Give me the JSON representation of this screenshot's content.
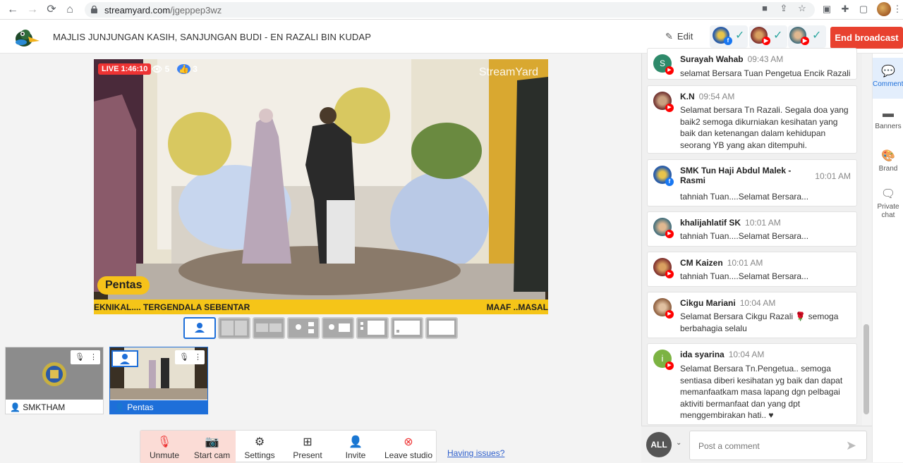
{
  "browser": {
    "url_host": "streamyard.com",
    "url_path": "/jgeppep3wz",
    "nav": [
      "back-icon",
      "forward-icon",
      "reload-icon",
      "home-icon"
    ]
  },
  "header": {
    "title": "MAJLIS JUNJUNGAN KASIH, SANJUNGAN BUDI - EN RAZALI BIN KUDAP",
    "edit_label": "Edit",
    "end_label": "End broadcast",
    "colors": {
      "end": "#e8412f",
      "check": "#2ea7a0"
    }
  },
  "stage": {
    "live_label": "LIVE 1:46:10",
    "viewers": "5",
    "likes": "3",
    "watermark": "StreamYard",
    "name_badge": "Pentas",
    "ticker_left": "EKNIKAL.... TERGENDALA SEBENTAR",
    "ticker_right": "MAAF ..MASAL",
    "colors": {
      "live": "#e33333",
      "ticker": "#f5c518"
    }
  },
  "tiles": [
    {
      "name": "SMKTHAM"
    },
    {
      "name": "Pentas"
    }
  ],
  "toolbar": {
    "unmute": "Unmute",
    "start_cam": "Start cam",
    "settings": "Settings",
    "present": "Present",
    "invite": "Invite",
    "leave": "Leave studio",
    "issues": "Having issues?"
  },
  "comments": [
    {
      "name": "Surayah Wahab",
      "time": "09:43 AM",
      "text": "selamat Bersara Tuan Pengetua Encik Razali",
      "source": "youtube"
    },
    {
      "name": "K.N",
      "time": "09:54 AM",
      "text": "Selamat bersara Tn Razali. Segala doa yang baik2 semoga dikurniakan kesihatan yang baik dan ketenangan dalam kehidupan seorang YB yang akan ditempuhi.",
      "source": "youtube"
    },
    {
      "name": "SMK Tun Haji Abdul Malek - Rasmi",
      "time": "10:01 AM",
      "text": "tahniah Tuan....Selamat Bersara...",
      "source": "facebook"
    },
    {
      "name": "khalijahlatif SK",
      "time": "10:01 AM",
      "text": "tahniah Tuan....Selamat Bersara...",
      "source": "youtube"
    },
    {
      "name": "CM Kaizen",
      "time": "10:01 AM",
      "text": "tahniah Tuan....Selamat Bersara...",
      "source": "youtube"
    },
    {
      "name": "Cikgu Mariani",
      "time": "10:04 AM",
      "text": "Selamat Bersara Cikgu Razali 🌹 semoga berbahagia selalu",
      "source": "youtube"
    },
    {
      "name": "ida syarina",
      "time": "10:04 AM",
      "text": "Selamat Bersara Tn.Pengetua.. semoga sentiasa diberi kesihatan yg baik dan dapat memanfaatkam masa lapang dgn pelbagai aktiviti bermanfaat dan yang dpt menggembirakan hati.. ♥",
      "source": "youtube"
    }
  ],
  "composer": {
    "all_label": "ALL",
    "placeholder": "Post a comment"
  },
  "rail": {
    "items": [
      "Comments",
      "Banners",
      "Brand",
      "Private chat"
    ]
  }
}
